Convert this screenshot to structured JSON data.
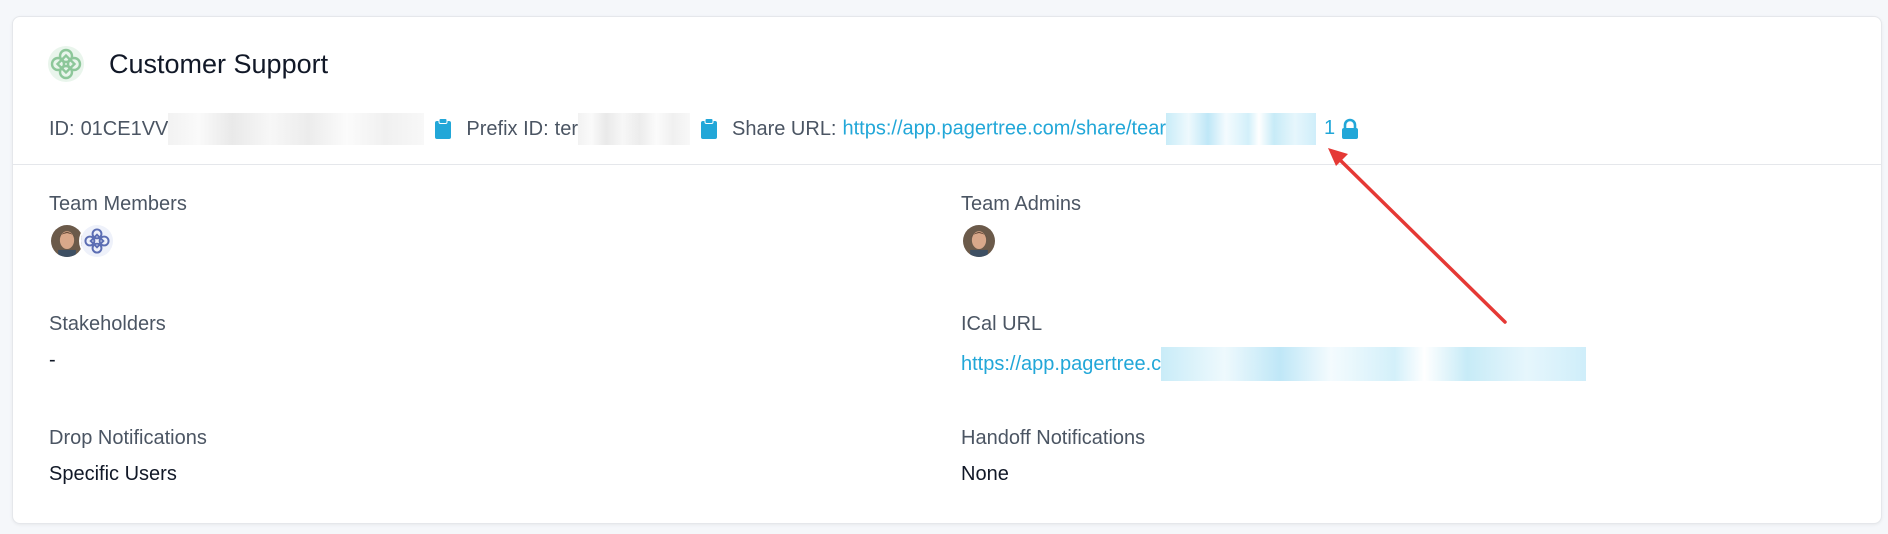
{
  "team": {
    "name": "Customer Support",
    "id_label": "ID:",
    "id_value": "01CE1VV",
    "prefix_label": "Prefix ID:",
    "prefix_value": "ter",
    "share_label": "Share URL:",
    "share_url": "https://app.pagertree.com/share/tear",
    "share_url_tail": "1"
  },
  "fields": {
    "team_members": {
      "label": "Team Members"
    },
    "team_admins": {
      "label": "Team Admins"
    },
    "stakeholders": {
      "label": "Stakeholders",
      "value": "-"
    },
    "ical": {
      "label": "ICal URL",
      "value": "https://app.pagertree.c"
    },
    "drop_notifications": {
      "label": "Drop Notifications",
      "value": "Specific Users"
    },
    "handoff_notifications": {
      "label": "Handoff Notifications",
      "value": "None"
    }
  },
  "icons": {
    "team_logo": "celtic-knot-icon",
    "copy": "clipboard-icon",
    "lock": "lock-icon"
  },
  "colors": {
    "link": "#22a7d8",
    "annotation_arrow": "#e53935",
    "team_logo": "#8dc79a",
    "group_avatar": "#5b6db3"
  }
}
